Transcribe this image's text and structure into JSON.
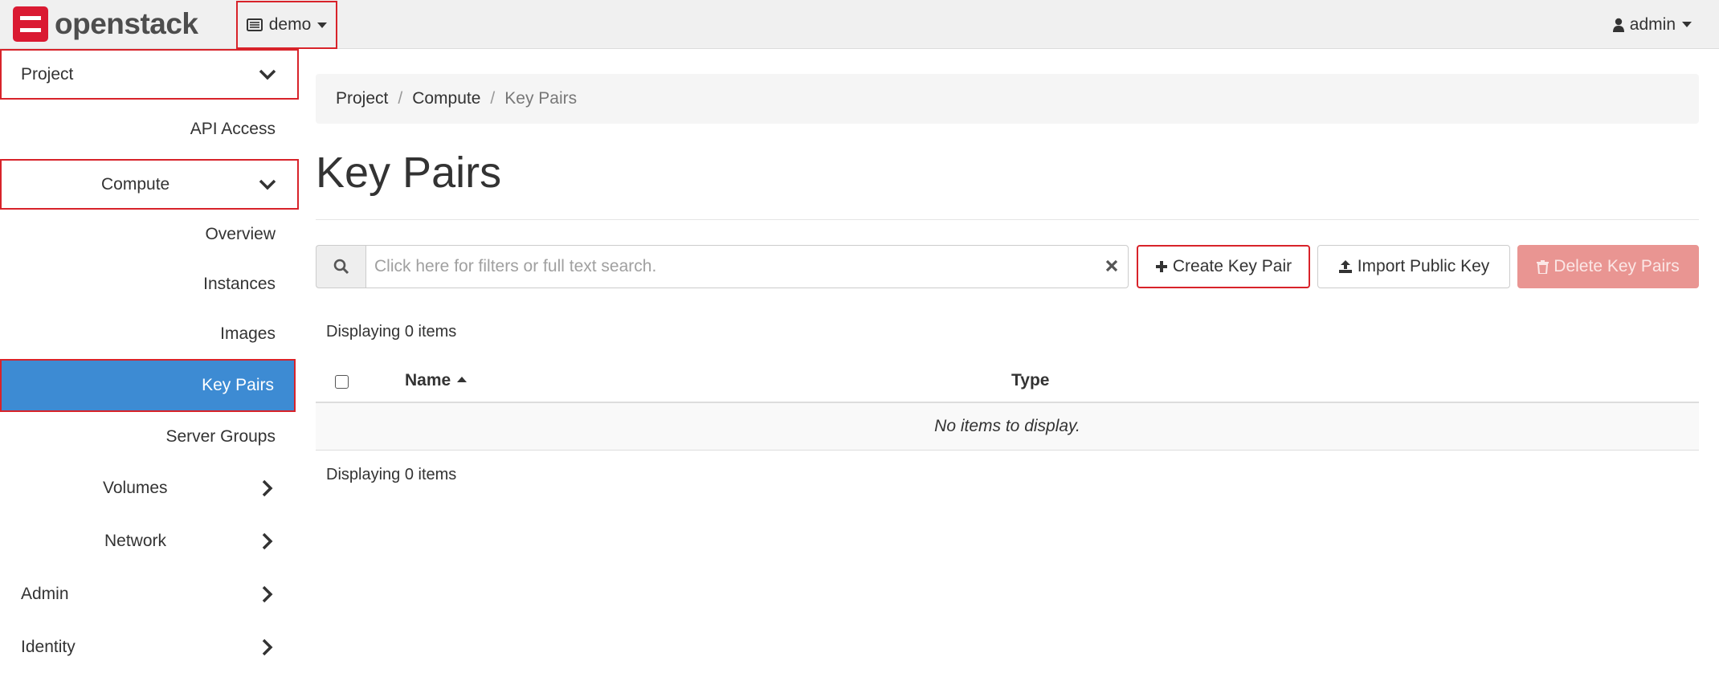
{
  "brand": {
    "name": "openstack",
    "accent_color": "#da1a32"
  },
  "header": {
    "project_switcher": {
      "label": "demo",
      "icon": "project-list-icon"
    },
    "user_menu": {
      "label": "admin",
      "icon": "user-icon"
    }
  },
  "sidebar": {
    "project": {
      "label": "Project",
      "expanded": true
    },
    "api_access": {
      "label": "API Access"
    },
    "compute": {
      "label": "Compute",
      "expanded": true
    },
    "overview": {
      "label": "Overview"
    },
    "instances": {
      "label": "Instances"
    },
    "images": {
      "label": "Images"
    },
    "key_pairs": {
      "label": "Key Pairs",
      "active": true,
      "active_color": "#3d8bd3"
    },
    "server_groups": {
      "label": "Server Groups"
    },
    "volumes": {
      "label": "Volumes",
      "expanded": false
    },
    "network": {
      "label": "Network",
      "expanded": false
    },
    "admin": {
      "label": "Admin",
      "expanded": false
    },
    "identity": {
      "label": "Identity",
      "expanded": false
    }
  },
  "breadcrumb": {
    "items": [
      "Project",
      "Compute",
      "Key Pairs"
    ],
    "separator": "/"
  },
  "page": {
    "title": "Key Pairs"
  },
  "search": {
    "placeholder": "Click here for filters or full text search.",
    "value": ""
  },
  "actions": {
    "create": {
      "label": "Create Key Pair",
      "icon": "plus-icon"
    },
    "import": {
      "label": "Import Public Key",
      "icon": "upload-icon"
    },
    "delete": {
      "label": "Delete Key Pairs",
      "icon": "trash-icon",
      "disabled": true
    }
  },
  "table": {
    "count_top": "Displaying 0 items",
    "columns": [
      "Name",
      "Type"
    ],
    "sort": {
      "column": "Name",
      "direction": "ascending"
    },
    "empty_message": "No items to display.",
    "count_bottom": "Displaying 0 items"
  },
  "highlight_color": "#d8232a"
}
